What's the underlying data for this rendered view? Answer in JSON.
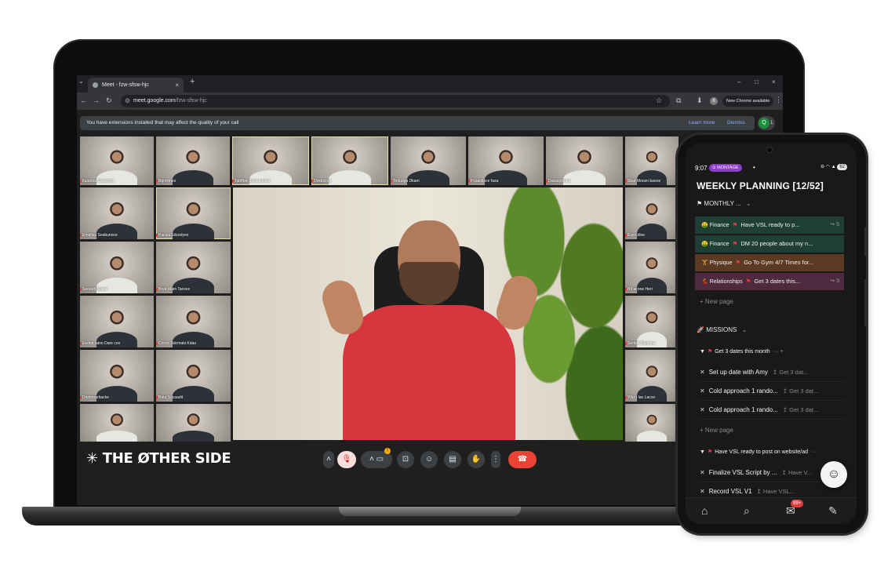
{
  "browser": {
    "tab_title": "Meet - fzw-sfsw-hjc",
    "tab_new": "+",
    "window_controls": [
      "–",
      "□",
      "×"
    ],
    "url_domain": "meet.google.com",
    "url_path": "/fzw-sfsw-hjc",
    "profile_initial": "8",
    "new_chrome_label": "New Chrome available"
  },
  "notice": {
    "text": "You have extensions installed that may affect the quality of your call",
    "learn_more": "Learn more",
    "dismiss": "Dismiss"
  },
  "people": {
    "avatar_initial": "Q",
    "count": "1"
  },
  "participants": [
    "Iluadoca Daezoca",
    "Bqnvdnvo",
    "Tabffow dactca tolaa",
    "Dwdochar",
    "Tedudga Dkam",
    "Pcaactioce faza",
    "Dubaqnvoeo",
    "Sbar Moozn baooe",
    "Emqfiso Soabunoce",
    "Pacica Sdcedyes",
    "Evercdive",
    "Seolard Sasai",
    "Boar Mam Tacoce",
    "Bd acooe Heri",
    "Eedon latoo Dare coe",
    "Cocce Sdcmabi Kdaa",
    "Sedodi Dasrsne",
    "Dontnoarbacke",
    "Bata Sdcaadit",
    "Ytkz i lao Lacoo"
  ],
  "brand": "THE ØTHER SIDE",
  "meet_controls": {
    "camera_alert": "!",
    "end_call_icon": "phone-hangup-icon"
  },
  "phone": {
    "time": "9:07",
    "app_pill": "MONTAGE",
    "battery": "62",
    "title": "WEEKLY PLANNING [12/52]",
    "monthly_label": "MONTHLY ...",
    "goals": [
      {
        "emoji": "🤑",
        "area": "Finance",
        "title": "Have VSL ready to p...",
        "sub": "↪ 5",
        "color": "#1f3f34"
      },
      {
        "emoji": "🤑",
        "area": "Finance",
        "title": "DM 20 people about my n...",
        "sub": "",
        "color": "#1f3f34"
      },
      {
        "emoji": "🏋",
        "area": "Physique",
        "title": "Go To Gym 4/7 Times for...",
        "sub": "",
        "color": "#5a3a22"
      },
      {
        "emoji": "💃",
        "area": "Relationships",
        "title": "Get 3 dates this...",
        "sub": "↪ 3",
        "color": "#4d2a3e"
      }
    ],
    "new_page": "New page",
    "missions_label": "MISSIONS",
    "mission_groups": [
      {
        "title": "Get 3 dates this month",
        "tasks": [
          {
            "title": "Set up date with Amy",
            "parent": "Get 3 dat..."
          },
          {
            "title": "Cold approach 1 rando...",
            "parent": "Get 3 dat..."
          },
          {
            "title": "Cold approach 1 rando...",
            "parent": "Get 3 dat..."
          }
        ]
      },
      {
        "title": "Have VSL ready to post on website/ad",
        "tasks": [
          {
            "title": "Finalize VSL Script by ...",
            "parent": "Have V..."
          },
          {
            "title": "Record VSL V1",
            "parent": "Have VSL..."
          }
        ]
      }
    ],
    "inbox_badge": "99+"
  }
}
